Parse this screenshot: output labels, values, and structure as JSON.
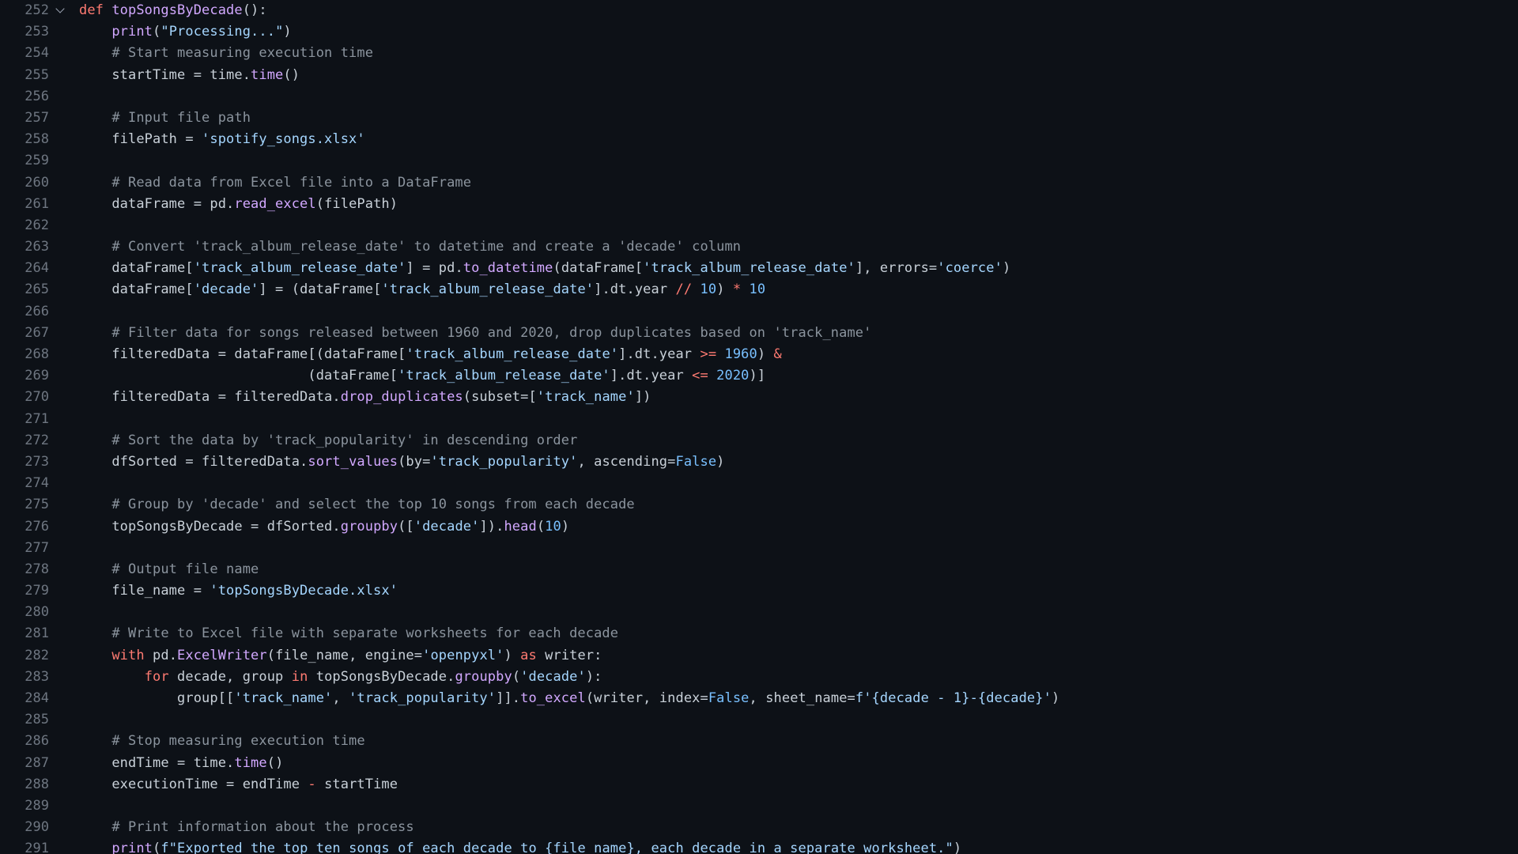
{
  "editor": {
    "theme": "dark",
    "background": "#0d1117",
    "gutter_color": "#6e7681",
    "text_color": "#c9d1d9",
    "language": "python",
    "fold_icon": "chevron-down-icon",
    "colors": {
      "keyword": "#ff7b72",
      "function_name": "#d2a8ff",
      "string": "#a5d6ff",
      "comment": "#8b949e",
      "number": "#79c0ff",
      "variable": "#c9d1d9"
    },
    "lines": [
      {
        "number": "252",
        "folded": false,
        "has_fold": true,
        "tokens": [
          {
            "t": "def ",
            "c": "keyword"
          },
          {
            "t": "topSongsByDecade",
            "c": "fnname"
          },
          {
            "t": "():",
            "c": "punct"
          }
        ]
      },
      {
        "number": "253",
        "has_fold": false,
        "tokens": [
          {
            "t": "    ",
            "c": "var"
          },
          {
            "t": "print",
            "c": "call"
          },
          {
            "t": "(",
            "c": "punct"
          },
          {
            "t": "\"Processing...\"",
            "c": "string"
          },
          {
            "t": ")",
            "c": "punct"
          }
        ]
      },
      {
        "number": "254",
        "has_fold": false,
        "tokens": [
          {
            "t": "    # Start measuring execution time",
            "c": "comment"
          }
        ]
      },
      {
        "number": "255",
        "has_fold": false,
        "tokens": [
          {
            "t": "    startTime = ",
            "c": "var"
          },
          {
            "t": "time",
            "c": "module"
          },
          {
            "t": ".",
            "c": "punct"
          },
          {
            "t": "time",
            "c": "call"
          },
          {
            "t": "()",
            "c": "punct"
          }
        ]
      },
      {
        "number": "256",
        "has_fold": false,
        "tokens": []
      },
      {
        "number": "257",
        "has_fold": false,
        "tokens": [
          {
            "t": "    # Input file path",
            "c": "comment"
          }
        ]
      },
      {
        "number": "258",
        "has_fold": false,
        "tokens": [
          {
            "t": "    filePath = ",
            "c": "var"
          },
          {
            "t": "'spotify_songs.xlsx'",
            "c": "string"
          }
        ]
      },
      {
        "number": "259",
        "has_fold": false,
        "tokens": []
      },
      {
        "number": "260",
        "has_fold": false,
        "tokens": [
          {
            "t": "    # Read data from Excel file into a DataFrame",
            "c": "comment"
          }
        ]
      },
      {
        "number": "261",
        "has_fold": false,
        "tokens": [
          {
            "t": "    dataFrame = ",
            "c": "var"
          },
          {
            "t": "pd",
            "c": "module"
          },
          {
            "t": ".",
            "c": "punct"
          },
          {
            "t": "read_excel",
            "c": "call"
          },
          {
            "t": "(",
            "c": "punct"
          },
          {
            "t": "filePath",
            "c": "var"
          },
          {
            "t": ")",
            "c": "punct"
          }
        ]
      },
      {
        "number": "262",
        "has_fold": false,
        "tokens": []
      },
      {
        "number": "263",
        "has_fold": false,
        "tokens": [
          {
            "t": "    # Convert 'track_album_release_date' to datetime and create a 'decade' column",
            "c": "comment"
          }
        ]
      },
      {
        "number": "264",
        "has_fold": false,
        "tokens": [
          {
            "t": "    dataFrame[",
            "c": "var"
          },
          {
            "t": "'track_album_release_date'",
            "c": "string"
          },
          {
            "t": "] = ",
            "c": "var"
          },
          {
            "t": "pd",
            "c": "module"
          },
          {
            "t": ".",
            "c": "punct"
          },
          {
            "t": "to_datetime",
            "c": "call"
          },
          {
            "t": "(",
            "c": "punct"
          },
          {
            "t": "dataFrame[",
            "c": "var"
          },
          {
            "t": "'track_album_release_date'",
            "c": "string"
          },
          {
            "t": "], errors=",
            "c": "var"
          },
          {
            "t": "'coerce'",
            "c": "string"
          },
          {
            "t": ")",
            "c": "punct"
          }
        ]
      },
      {
        "number": "265",
        "has_fold": false,
        "tokens": [
          {
            "t": "    dataFrame[",
            "c": "var"
          },
          {
            "t": "'decade'",
            "c": "string"
          },
          {
            "t": "] = (dataFrame[",
            "c": "var"
          },
          {
            "t": "'track_album_release_date'",
            "c": "string"
          },
          {
            "t": "].dt.year ",
            "c": "var"
          },
          {
            "t": "//",
            "c": "op"
          },
          {
            "t": " ",
            "c": "var"
          },
          {
            "t": "10",
            "c": "number"
          },
          {
            "t": ") ",
            "c": "var"
          },
          {
            "t": "*",
            "c": "op"
          },
          {
            "t": " ",
            "c": "var"
          },
          {
            "t": "10",
            "c": "number"
          }
        ]
      },
      {
        "number": "266",
        "has_fold": false,
        "tokens": []
      },
      {
        "number": "267",
        "has_fold": false,
        "tokens": [
          {
            "t": "    # Filter data for songs released between 1960 and 2020, drop duplicates based on 'track_name'",
            "c": "comment"
          }
        ]
      },
      {
        "number": "268",
        "has_fold": false,
        "tokens": [
          {
            "t": "    filteredData = dataFrame[(dataFrame[",
            "c": "var"
          },
          {
            "t": "'track_album_release_date'",
            "c": "string"
          },
          {
            "t": "].dt.year ",
            "c": "var"
          },
          {
            "t": ">=",
            "c": "op"
          },
          {
            "t": " ",
            "c": "var"
          },
          {
            "t": "1960",
            "c": "number"
          },
          {
            "t": ") ",
            "c": "var"
          },
          {
            "t": "&",
            "c": "op"
          }
        ]
      },
      {
        "number": "269",
        "has_fold": false,
        "tokens": [
          {
            "t": "                            (dataFrame[",
            "c": "var"
          },
          {
            "t": "'track_album_release_date'",
            "c": "string"
          },
          {
            "t": "].dt.year ",
            "c": "var"
          },
          {
            "t": "<=",
            "c": "op"
          },
          {
            "t": " ",
            "c": "var"
          },
          {
            "t": "2020",
            "c": "number"
          },
          {
            "t": ")]",
            "c": "var"
          }
        ]
      },
      {
        "number": "270",
        "has_fold": false,
        "tokens": [
          {
            "t": "    filteredData = filteredData",
            "c": "var"
          },
          {
            "t": ".",
            "c": "punct"
          },
          {
            "t": "drop_duplicates",
            "c": "call"
          },
          {
            "t": "(subset=[",
            "c": "var"
          },
          {
            "t": "'track_name'",
            "c": "string"
          },
          {
            "t": "])",
            "c": "var"
          }
        ]
      },
      {
        "number": "271",
        "has_fold": false,
        "tokens": []
      },
      {
        "number": "272",
        "has_fold": false,
        "tokens": [
          {
            "t": "    # Sort the data by 'track_popularity' in descending order",
            "c": "comment"
          }
        ]
      },
      {
        "number": "273",
        "has_fold": false,
        "tokens": [
          {
            "t": "    dfSorted = filteredData",
            "c": "var"
          },
          {
            "t": ".",
            "c": "punct"
          },
          {
            "t": "sort_values",
            "c": "call"
          },
          {
            "t": "(by=",
            "c": "var"
          },
          {
            "t": "'track_popularity'",
            "c": "string"
          },
          {
            "t": ", ascending=",
            "c": "var"
          },
          {
            "t": "False",
            "c": "const"
          },
          {
            "t": ")",
            "c": "var"
          }
        ]
      },
      {
        "number": "274",
        "has_fold": false,
        "tokens": []
      },
      {
        "number": "275",
        "has_fold": false,
        "tokens": [
          {
            "t": "    # Group by 'decade' and select the top 10 songs from each decade",
            "c": "comment"
          }
        ]
      },
      {
        "number": "276",
        "has_fold": false,
        "tokens": [
          {
            "t": "    topSongsByDecade = dfSorted",
            "c": "var"
          },
          {
            "t": ".",
            "c": "punct"
          },
          {
            "t": "groupby",
            "c": "call"
          },
          {
            "t": "([",
            "c": "var"
          },
          {
            "t": "'decade'",
            "c": "string"
          },
          {
            "t": "])",
            "c": "var"
          },
          {
            "t": ".",
            "c": "punct"
          },
          {
            "t": "head",
            "c": "call"
          },
          {
            "t": "(",
            "c": "var"
          },
          {
            "t": "10",
            "c": "number"
          },
          {
            "t": ")",
            "c": "var"
          }
        ]
      },
      {
        "number": "277",
        "has_fold": false,
        "tokens": []
      },
      {
        "number": "278",
        "has_fold": false,
        "tokens": [
          {
            "t": "    # Output file name",
            "c": "comment"
          }
        ]
      },
      {
        "number": "279",
        "has_fold": false,
        "tokens": [
          {
            "t": "    file_name = ",
            "c": "var"
          },
          {
            "t": "'topSongsByDecade.xlsx'",
            "c": "string"
          }
        ]
      },
      {
        "number": "280",
        "has_fold": false,
        "tokens": []
      },
      {
        "number": "281",
        "has_fold": false,
        "tokens": [
          {
            "t": "    # Write to Excel file with separate worksheets for each decade",
            "c": "comment"
          }
        ]
      },
      {
        "number": "282",
        "has_fold": false,
        "tokens": [
          {
            "t": "    ",
            "c": "var"
          },
          {
            "t": "with",
            "c": "keyword"
          },
          {
            "t": " pd",
            "c": "module"
          },
          {
            "t": ".",
            "c": "punct"
          },
          {
            "t": "ExcelWriter",
            "c": "call"
          },
          {
            "t": "(file_name, engine=",
            "c": "var"
          },
          {
            "t": "'openpyxl'",
            "c": "string"
          },
          {
            "t": ") ",
            "c": "var"
          },
          {
            "t": "as",
            "c": "keyword"
          },
          {
            "t": " writer:",
            "c": "var"
          }
        ]
      },
      {
        "number": "283",
        "has_fold": false,
        "tokens": [
          {
            "t": "        ",
            "c": "var"
          },
          {
            "t": "for",
            "c": "keyword"
          },
          {
            "t": " decade, group ",
            "c": "var"
          },
          {
            "t": "in",
            "c": "keyword"
          },
          {
            "t": " topSongsByDecade",
            "c": "var"
          },
          {
            "t": ".",
            "c": "punct"
          },
          {
            "t": "groupby",
            "c": "call"
          },
          {
            "t": "(",
            "c": "var"
          },
          {
            "t": "'decade'",
            "c": "string"
          },
          {
            "t": "):",
            "c": "var"
          }
        ]
      },
      {
        "number": "284",
        "has_fold": false,
        "tokens": [
          {
            "t": "            group[[",
            "c": "var"
          },
          {
            "t": "'track_name'",
            "c": "string"
          },
          {
            "t": ", ",
            "c": "var"
          },
          {
            "t": "'track_popularity'",
            "c": "string"
          },
          {
            "t": "]]",
            "c": "var"
          },
          {
            "t": ".",
            "c": "punct"
          },
          {
            "t": "to_excel",
            "c": "call"
          },
          {
            "t": "(writer, index=",
            "c": "var"
          },
          {
            "t": "False",
            "c": "const"
          },
          {
            "t": ", sheet_name=",
            "c": "var"
          },
          {
            "t": "f'{decade - 1}-{decade}'",
            "c": "string"
          },
          {
            "t": ")",
            "c": "var"
          }
        ]
      },
      {
        "number": "285",
        "has_fold": false,
        "tokens": []
      },
      {
        "number": "286",
        "has_fold": false,
        "tokens": [
          {
            "t": "    # Stop measuring execution time",
            "c": "comment"
          }
        ]
      },
      {
        "number": "287",
        "has_fold": false,
        "tokens": [
          {
            "t": "    endTime = ",
            "c": "var"
          },
          {
            "t": "time",
            "c": "module"
          },
          {
            "t": ".",
            "c": "punct"
          },
          {
            "t": "time",
            "c": "call"
          },
          {
            "t": "()",
            "c": "var"
          }
        ]
      },
      {
        "number": "288",
        "has_fold": false,
        "tokens": [
          {
            "t": "    executionTime = endTime ",
            "c": "var"
          },
          {
            "t": "-",
            "c": "op"
          },
          {
            "t": " startTime",
            "c": "var"
          }
        ]
      },
      {
        "number": "289",
        "has_fold": false,
        "tokens": []
      },
      {
        "number": "290",
        "has_fold": false,
        "tokens": [
          {
            "t": "    # Print information about the process",
            "c": "comment"
          }
        ]
      },
      {
        "number": "291",
        "has_fold": false,
        "tokens": [
          {
            "t": "    ",
            "c": "var"
          },
          {
            "t": "print",
            "c": "call"
          },
          {
            "t": "(",
            "c": "var"
          },
          {
            "t": "f\"Exported the top ten songs of each decade to {file_name}, each decade in a separate worksheet.\"",
            "c": "string"
          },
          {
            "t": ")",
            "c": "var"
          }
        ]
      }
    ]
  }
}
